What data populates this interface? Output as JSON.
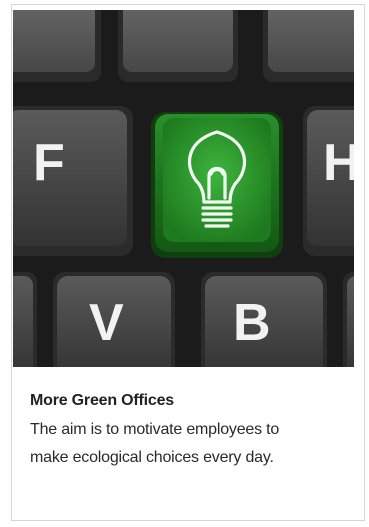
{
  "card": {
    "image_alt_icon": "lightbulb-icon",
    "keys": [
      "F",
      "H",
      "V",
      "B"
    ],
    "title": "More Green Offices",
    "description_lines": [
      "The aim is to motivate employees to",
      "make ecological choices every day."
    ]
  },
  "colors": {
    "green_key": "#2f9a2f",
    "keyboard_bg": "#1d1d1d",
    "key_face": "#4a4a4a"
  }
}
